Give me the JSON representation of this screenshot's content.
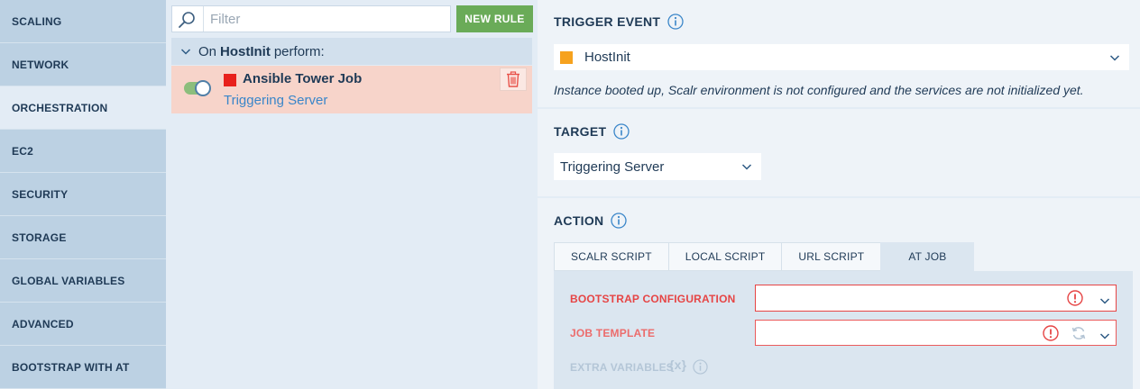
{
  "sidebar": {
    "items": [
      {
        "label": "SCALING",
        "active": false
      },
      {
        "label": "NETWORK",
        "active": false
      },
      {
        "label": "ORCHESTRATION",
        "active": true
      },
      {
        "label": "EC2",
        "active": false
      },
      {
        "label": "SECURITY",
        "active": false
      },
      {
        "label": "STORAGE",
        "active": false
      },
      {
        "label": "GLOBAL VARIABLES",
        "active": false
      },
      {
        "label": "ADVANCED",
        "active": false
      },
      {
        "label": "BOOTSTRAP WITH AT",
        "active": false
      }
    ]
  },
  "rules": {
    "search_placeholder": "Filter",
    "new_rule_label": "NEW RULE",
    "group": {
      "prefix": "On",
      "event": "HostInit",
      "suffix": "perform:"
    },
    "rule": {
      "title": "Ansible Tower Job",
      "subtitle": "Triggering Server",
      "enabled": true,
      "color": "#e8211c"
    }
  },
  "detail": {
    "trigger_event": {
      "title": "TRIGGER EVENT",
      "value": "HostInit",
      "swatch_color": "#f6a21e",
      "description": "Instance booted up, Scalr environment is not configured and the services are not initialized yet."
    },
    "target": {
      "title": "TARGET",
      "value": "Triggering Server"
    },
    "action": {
      "title": "ACTION",
      "tabs": [
        {
          "label": "SCALR SCRIPT",
          "active": false
        },
        {
          "label": "LOCAL SCRIPT",
          "active": false
        },
        {
          "label": "URL SCRIPT",
          "active": false
        },
        {
          "label": "AT JOB",
          "active": true
        }
      ],
      "fields": {
        "bootstrap_label": "BOOTSTRAP CONFIGURATION",
        "job_template_label": "JOB TEMPLATE",
        "extra_variables_label": "EXTRA VARIABLES",
        "extra_variables_badge": "{x}"
      }
    }
  }
}
